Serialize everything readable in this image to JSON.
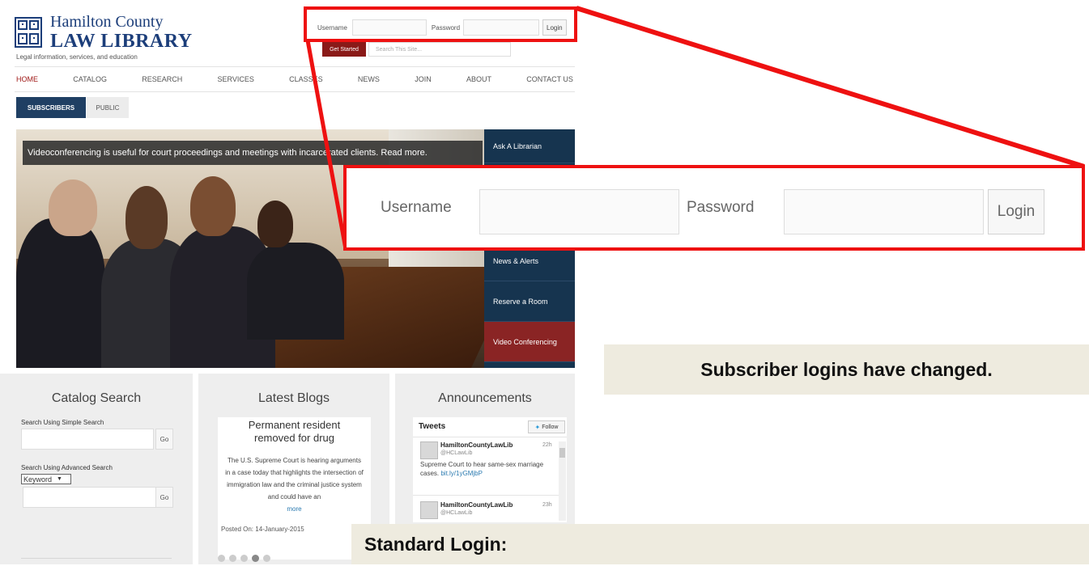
{
  "header": {
    "logo_line1": "Hamilton County",
    "logo_line2": "LAW LIBRARY",
    "tagline": "Legal information, services, and education"
  },
  "login_bar": {
    "username_label": "Username",
    "password_label": "Password",
    "login_label": "Login"
  },
  "get_started_label": "Get Started",
  "search_placeholder": "Search This Site...",
  "nav": [
    "HOME",
    "CATALOG",
    "RESEARCH",
    "SERVICES",
    "CLASSES",
    "NEWS",
    "JOIN",
    "ABOUT",
    "CONTACT US"
  ],
  "tabs": {
    "subscribers": "SUBSCRIBERS",
    "public": "PUBLIC"
  },
  "hero": {
    "caption": "Videoconferencing is useful for court proceedings and meetings with incarcerated clients. Read more."
  },
  "side_menu": [
    "Ask A Librarian",
    "News & Alerts",
    "Reserve a Room",
    "Video Conferencing"
  ],
  "zoom": {
    "username_label": "Username",
    "password_label": "Password",
    "login_label": "Login"
  },
  "notices": {
    "changed": "Subscriber logins have changed.",
    "standard": "Standard Login:"
  },
  "catalog": {
    "title": "Catalog Search",
    "simple_label": "Search Using Simple Search",
    "go": "Go",
    "advanced_label": "Search Using Advanced Search",
    "select_value": "Keyword"
  },
  "blogs": {
    "title": "Latest Blogs",
    "headline": "Permanent resident removed for drug",
    "body": "The U.S. Supreme Court is hearing arguments in a case today that highlights the intersection of immigration law and the criminal justice system and could have an",
    "more": "more",
    "posted": "Posted On: 14-January-2015"
  },
  "announcements": {
    "title": "Announcements",
    "tweets_label": "Tweets",
    "follow_label": "Follow",
    "tweets": [
      {
        "name": "HamiltonCountyLawLib",
        "handle": "@HCLawLib",
        "time": "22h",
        "text": "Supreme Court to hear same-sex marriage cases.",
        "link": "bit.ly/1yGMjbP"
      },
      {
        "name": "HamiltonCountyLawLib",
        "handle": "@HCLawLib",
        "time": "23h",
        "text": "",
        "link": ""
      }
    ]
  },
  "colors": {
    "accent_red": "#ee1111",
    "nav_blue": "#1f3f63",
    "brand_red": "#8a1a18"
  }
}
